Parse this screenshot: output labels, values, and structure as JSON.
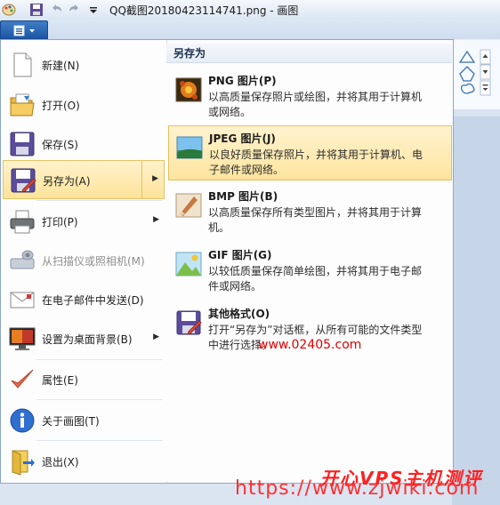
{
  "window": {
    "title": "QQ截图20180423114741.png - 画图"
  },
  "menu": {
    "items": [
      {
        "label": "新建(N)",
        "icon": "new-file-icon"
      },
      {
        "label": "打开(O)",
        "icon": "open-folder-icon"
      },
      {
        "label": "保存(S)",
        "icon": "floppy-icon"
      },
      {
        "label": "另存为(A)",
        "icon": "save-as-icon"
      },
      {
        "label": "打印(P)",
        "icon": "printer-icon"
      },
      {
        "label": "从扫描仪或照相机(M)",
        "icon": "scanner-icon"
      },
      {
        "label": "在电子邮件中发送(D)",
        "icon": "email-icon"
      },
      {
        "label": "设置为桌面背景(B)",
        "icon": "desktop-icon"
      },
      {
        "label": "属性(E)",
        "icon": "checkmark-icon"
      },
      {
        "label": "关于画图(T)",
        "icon": "info-icon"
      },
      {
        "label": "退出(X)",
        "icon": "exit-icon"
      }
    ]
  },
  "submenu": {
    "title": "另存为",
    "items": [
      {
        "name": "PNG 图片(P)",
        "desc": "以高质量保存照片或绘图，并将其用于计算机或网络。"
      },
      {
        "name": "JPEG 图片(J)",
        "desc": "以良好质量保存照片，并将其用于计算机、电子邮件或网络。"
      },
      {
        "name": "BMP 图片(B)",
        "desc": "以高质量保存所有类型图片，并将其用于计算机。"
      },
      {
        "name": "GIF 图片(G)",
        "desc": "以较低质量保存简单绘图，并将其用于电子邮件或网络。"
      },
      {
        "name": "其他格式(O)",
        "desc": "打开“另存为”对话框，从所有可能的文件类型中进行选择。"
      }
    ]
  },
  "watermarks": {
    "url1": "www.02405.com",
    "brand": "开心VPS主机测评",
    "url2": "https://www.zjwiki.com"
  },
  "colors": {
    "accent": "#1d56a5",
    "highlight": "#fde39a"
  }
}
